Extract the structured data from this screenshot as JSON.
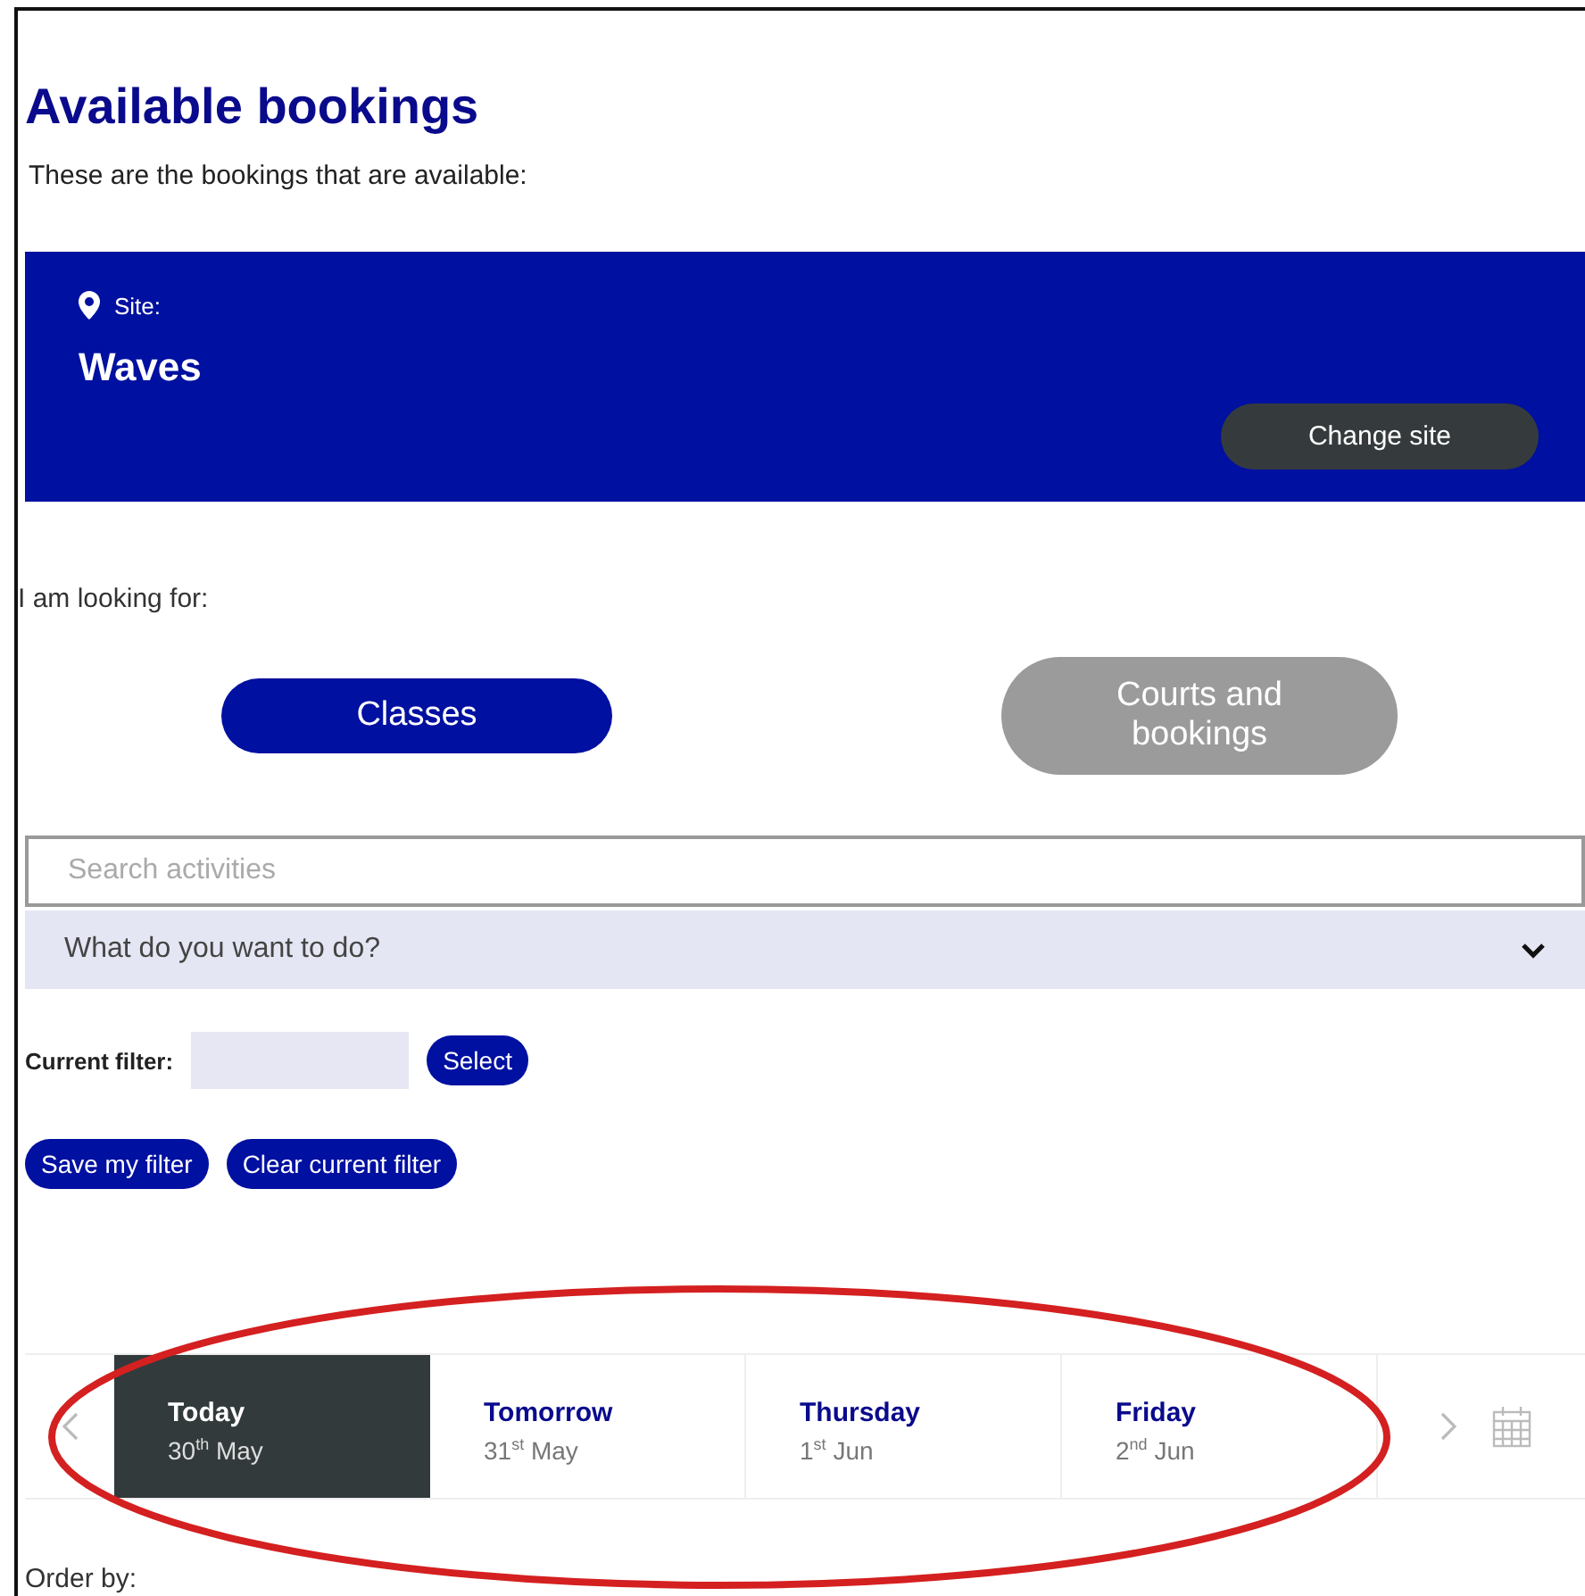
{
  "title": "Available bookings",
  "subtitle": "These are the bookings that are available:",
  "site": {
    "label": "Site:",
    "name": "Waves",
    "button": "Change site"
  },
  "looking_for": {
    "label": "I am looking for:",
    "options": [
      {
        "label": "Classes",
        "selected": true
      },
      {
        "label": "Courts and bookings",
        "selected": false
      }
    ]
  },
  "search": {
    "placeholder": "Search activities"
  },
  "dropdown": {
    "placeholder": "What do you want to do?"
  },
  "filter": {
    "label": "Current filter:",
    "button": "Select"
  },
  "filter_buttons": [
    "Save my filter",
    "Clear current filter"
  ],
  "dates": [
    {
      "day": "Today",
      "date": "30$^{th}$ May",
      "selected": true
    },
    {
      "day": "Tomorrow",
      "date": "31$^{st}$ May",
      "selected": false
    },
    {
      "day": "Thursday",
      "date": "1$^{st}$ Jun",
      "selected": false
    },
    {
      "day": "Friday",
      "date": "2$^{nd}$ Jun",
      "selected": false
    }
  ],
  "order_by": "Order by:"
}
